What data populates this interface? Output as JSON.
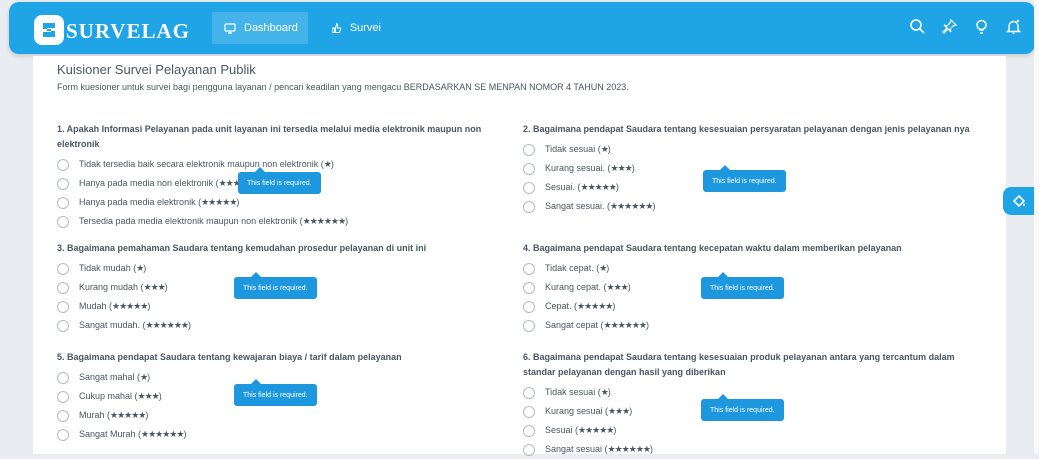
{
  "app": {
    "brand": "SURVELAG"
  },
  "nav": {
    "dashboard": "Dashboard",
    "survei": "Survei"
  },
  "toolbar": {
    "icons": [
      "search-icon",
      "pin-icon",
      "lightbulb-icon",
      "bell-icon"
    ]
  },
  "page": {
    "title": "Kuisioner Survei Pelayanan Publik",
    "description": "Form kuesioner untuk survei bagi pengguna layanan / pencari keadilan yang mengacu BERDASARKAN SE MENPAN NOMOR 4 TAHUN 2023."
  },
  "validation": {
    "message": "This field is required."
  },
  "questions": [
    {
      "title": "1. Apakah Informasi Pelayanan pada unit layanan ini tersedia melalui media elektronik maupun non elektronik",
      "options": [
        {
          "label": "Tidak tersedia baik secara elektronik maupun non elektronik (",
          "stars": "★",
          "close": ")"
        },
        {
          "label": "Hanya pada media non elektronik (",
          "stars": "★★★",
          "close": ")"
        },
        {
          "label": "Hanya pada media elektronik (",
          "stars": "★★★★★",
          "close": ")"
        },
        {
          "label": "Tersedia pada media elektronik maupun non elektronik (",
          "stars": "★★★★★★",
          "close": ")"
        }
      ]
    },
    {
      "title": "2. Bagaimana pendapat Saudara tentang kesesuaian persyaratan pelayanan dengan jenis pelayanan nya",
      "options": [
        {
          "label": "Tidak sesuai (",
          "stars": "★",
          "close": ")"
        },
        {
          "label": "Kurang sesuai. (",
          "stars": "★★★",
          "close": ")"
        },
        {
          "label": "Sesuai. (",
          "stars": "★★★★★",
          "close": ")"
        },
        {
          "label": "Sangat sesuai. (",
          "stars": "★★★★★★",
          "close": ")"
        }
      ]
    },
    {
      "title": "3. Bagaimana pemahaman Saudara tentang kemudahan prosedur pelayanan di unit ini",
      "options": [
        {
          "label": "Tidak mudah (",
          "stars": "★",
          "close": ")"
        },
        {
          "label": "Kurang mudah (",
          "stars": "★★★",
          "close": ")"
        },
        {
          "label": "Mudah (",
          "stars": "★★★★★",
          "close": ")"
        },
        {
          "label": "Sangat mudah. (",
          "stars": "★★★★★★",
          "close": ")"
        }
      ]
    },
    {
      "title": "4. Bagaimana pendapat Saudara tentang kecepatan waktu dalam memberikan pelayanan",
      "options": [
        {
          "label": "Tidak cepat. (",
          "stars": "★",
          "close": ")"
        },
        {
          "label": "Kurang cepat. (",
          "stars": "★★★",
          "close": ")"
        },
        {
          "label": "Cepat. (",
          "stars": "★★★★★",
          "close": ")"
        },
        {
          "label": "Sangat cepat (",
          "stars": "★★★★★★",
          "close": ")"
        }
      ]
    },
    {
      "title": "5. Bagaimana pendapat Saudara tentang kewajaran biaya / tarif dalam pelayanan",
      "options": [
        {
          "label": "Sangat mahal (",
          "stars": "★",
          "close": ")"
        },
        {
          "label": "Cukup mahal (",
          "stars": "★★★",
          "close": ")"
        },
        {
          "label": "Murah (",
          "stars": "★★★★★",
          "close": ")"
        },
        {
          "label": "Sangat Murah (",
          "stars": "★★★★★★",
          "close": ")"
        }
      ]
    },
    {
      "title": "6. Bagaimana pendapat Saudara tentang kesesuaian produk pelayanan antara yang tercantum dalam standar pelayanan dengan hasil yang diberikan",
      "options": [
        {
          "label": "Tidak sesuai (",
          "stars": "★",
          "close": ")"
        },
        {
          "label": "Kurang sesuai (",
          "stars": "★★★",
          "close": ")"
        },
        {
          "label": "Sesuai (",
          "stars": "★★★★★",
          "close": ")"
        },
        {
          "label": "Sangat sesuai (",
          "stars": "★★★★★★",
          "close": ")"
        }
      ]
    }
  ],
  "colors": {
    "primary": "#1fa5e6",
    "tooltip": "#1d98de",
    "background": "#e9ecf1"
  }
}
